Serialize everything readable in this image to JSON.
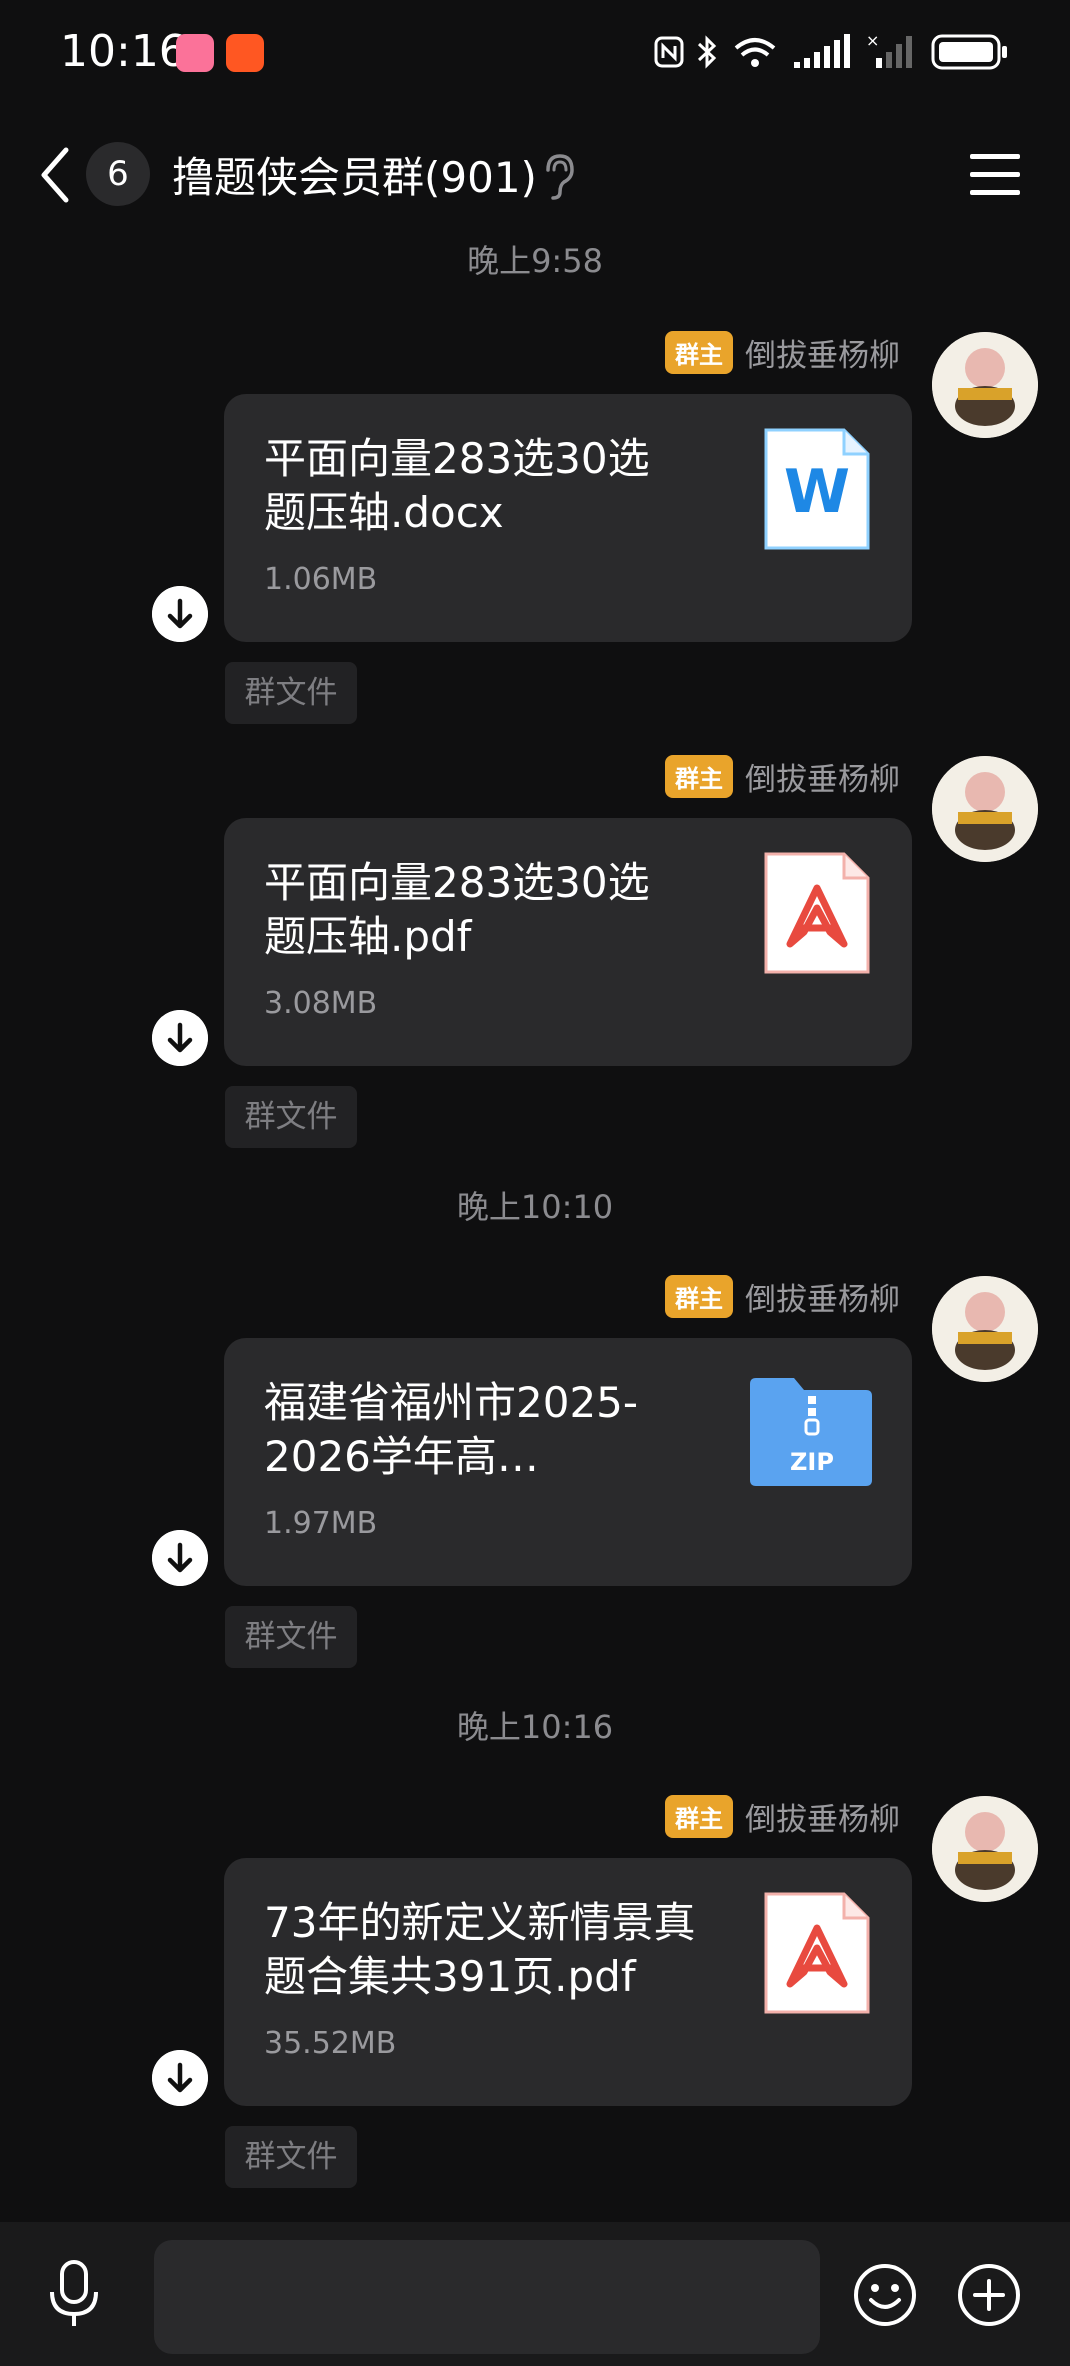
{
  "status_bar": {
    "time": "10:16"
  },
  "header": {
    "unread_count": "6",
    "group_title": "撸题侠会员群(901)"
  },
  "messages": [
    {
      "timestamp": "晚上9:58",
      "role": "群主",
      "sender": "倒拔垂杨柳",
      "file_name": "平面向量283选30选题压轴.docx",
      "file_size": "1.06MB",
      "file_type": "word-doc-icon",
      "tag": "群文件"
    },
    {
      "timestamp": "",
      "role": "群主",
      "sender": "倒拔垂杨柳",
      "file_name": "平面向量283选30选题压轴.pdf",
      "file_size": "3.08MB",
      "file_type": "pdf-icon",
      "tag": "群文件"
    },
    {
      "timestamp": "晚上10:10",
      "role": "群主",
      "sender": "倒拔垂杨柳",
      "file_name": "福建省福州市2025-2026学年高…",
      "file_size": "1.97MB",
      "file_type": "zip-folder-icon",
      "zip_label": "ZIP",
      "tag": "群文件"
    },
    {
      "timestamp": "晚上10:16",
      "role": "群主",
      "sender": "倒拔垂杨柳",
      "file_name": "73年的新定义新情景真题合集共391页.pdf",
      "file_size": "35.52MB",
      "file_type": "pdf-icon",
      "tag": "群文件"
    }
  ],
  "input_bar": {
    "placeholder": ""
  },
  "colors": {
    "background": "#0f0f10",
    "card": "#2a2a2c",
    "role_badge": "#e9a42b",
    "word_blue": "#1e88e5",
    "pdf_red": "#e84a3f",
    "zip_blue": "#5aa3f0"
  }
}
